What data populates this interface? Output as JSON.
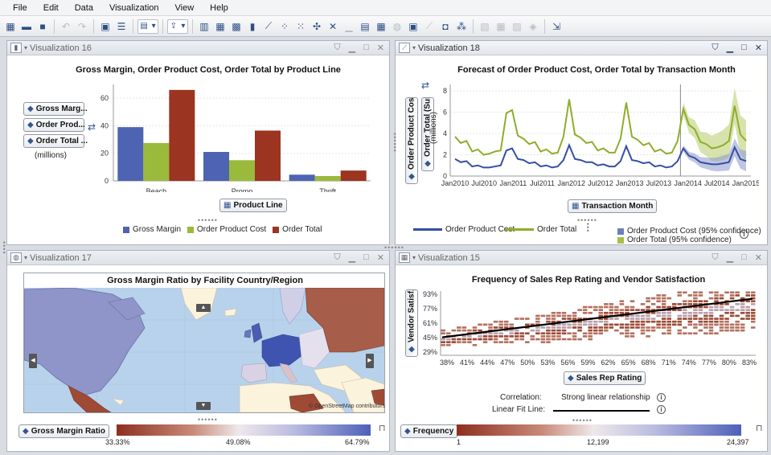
{
  "menu": [
    "File",
    "Edit",
    "Data",
    "Visualization",
    "View",
    "Help"
  ],
  "panels": {
    "v16": {
      "title": "Visualization 16",
      "chart_title": "Gross Margin, Order Product Cost, Order Total by Product Line",
      "roles": [
        "Gross Marg...",
        "Order Prod...",
        "Order Total ..."
      ],
      "units": "(millions)",
      "x_role": "Product Line",
      "chart_data": {
        "type": "bar",
        "categories": [
          "Beach",
          "Promo",
          "Thrift"
        ],
        "series": [
          {
            "name": "Gross Margin",
            "values": [
              39,
              21,
              4.5
            ],
            "color": "#4f63b3"
          },
          {
            "name": "Order Product Cost",
            "values": [
              27.5,
              15,
              3.5
            ],
            "color": "#9aba3c"
          },
          {
            "name": "Order Total",
            "values": [
              66,
              36.5,
              7.5
            ],
            "color": "#9b3420"
          }
        ],
        "yticks": [
          "0",
          "20",
          "40",
          "60"
        ],
        "ylim": [
          0,
          70
        ]
      }
    },
    "v18": {
      "title": "Visualization 18",
      "chart_title": "Forecast of Order Product Cost, Order Total by Transaction Month",
      "y_role1": "Order Product Cost (S...",
      "y_role2": "Order Total (Sum)",
      "units": "(millions)",
      "x_role": "Transaction Month",
      "legend": [
        "Order Product Cost",
        "Order Total",
        "Order Product Cost (95% confidence)",
        "Order Total (95% confidence)"
      ],
      "chart_data": {
        "type": "line",
        "x": [
          "Jan2010",
          "Jul2010",
          "Jan2011",
          "Jul2011",
          "Jan2012",
          "Jul2012",
          "Jan2013",
          "Jul2013",
          "Jan2014",
          "Jul2014",
          "Jan2015"
        ],
        "yticks": [
          "0",
          "2",
          "4",
          "6",
          "8"
        ],
        "ylim": [
          0,
          8.6
        ],
        "series": [
          {
            "name": "Order Total",
            "color": "#8fad2b",
            "values": [
              3.7,
              3.1,
              3.3,
              2.3,
              2.5,
              2.0,
              2.1,
              2.3,
              2.4,
              5.9,
              6.2,
              3.8,
              3.5,
              3.0,
              3.2,
              2.3,
              2.5,
              2.1,
              2.2,
              3.7,
              7.2,
              3.9,
              3.6,
              3.1,
              3.2,
              2.4,
              2.6,
              2.2,
              2.2,
              3.5,
              6.9,
              3.7,
              3.4,
              2.9,
              3.1,
              2.3,
              2.5,
              2.1,
              2.2,
              3.3
            ]
          },
          {
            "name": "Order Product Cost",
            "color": "#344fa3",
            "values": [
              1.6,
              1.3,
              1.4,
              0.9,
              1.0,
              0.8,
              0.8,
              0.9,
              1.0,
              2.4,
              2.6,
              1.6,
              1.5,
              1.2,
              1.3,
              0.9,
              1.0,
              0.8,
              0.9,
              1.5,
              2.9,
              1.6,
              1.5,
              1.3,
              1.3,
              1.0,
              1.1,
              0.9,
              0.9,
              1.4,
              2.8,
              1.5,
              1.4,
              1.2,
              1.3,
              0.9,
              1.0,
              0.8,
              0.9,
              1.4
            ]
          }
        ],
        "forecast": {
          "total": [
            6.3,
            4.8,
            4.4,
            3.2,
            3.0,
            2.6,
            2.7,
            2.9,
            3.3,
            6.6,
            3.9,
            3.3
          ],
          "cost": [
            2.6,
            1.9,
            1.7,
            1.3,
            1.2,
            1.1,
            1.1,
            1.2,
            1.3,
            2.7,
            1.6,
            1.4
          ]
        }
      }
    },
    "v17": {
      "title": "Visualization 17",
      "chart_title": "Gross Margin Ratio by Facility Country/Region",
      "attribution": "© OpenStreetMap contributors",
      "role": "Gross Margin Ratio",
      "gradient_labels": [
        "33.33%",
        "49.08%",
        "64.79%"
      ]
    },
    "v15": {
      "title": "Visualization 15",
      "chart_title": "Frequency of Sales Rep Rating and Vendor Satisfaction",
      "y_role": "Vendor Satisf...",
      "x_role": "Sales Rep Rating",
      "correlation_label": "Correlation:",
      "correlation_value": "Strong linear relationship",
      "fit_label": "Linear Fit Line:",
      "role": "Frequency",
      "gradient_labels": [
        "1",
        "12,199",
        "24,397"
      ],
      "chart_data": {
        "type": "heatmap",
        "xticks": [
          "38%",
          "41%",
          "44%",
          "47%",
          "50%",
          "53%",
          "56%",
          "59%",
          "62%",
          "65%",
          "68%",
          "71%",
          "74%",
          "77%",
          "80%",
          "83%"
        ],
        "yticks": [
          "93%",
          "77%",
          "61%",
          "45%",
          "29%"
        ]
      }
    }
  }
}
